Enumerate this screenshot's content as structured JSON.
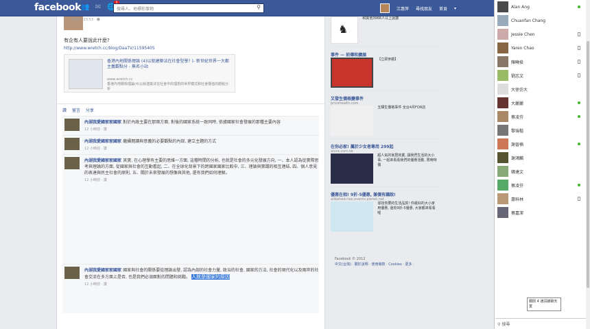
{
  "topbar": {
    "logo": "facebook",
    "notif_count": "1",
    "search_placeholder": "搜尋人、地標和事物",
    "user_name": "江惠萍",
    "home_label": "尋找朋友",
    "menu_label": "首頁"
  },
  "story": {
    "meta": "星期三 23:53 · ☻",
    "question": "有企有人要說此什麼?",
    "url": "http://www.wretch.cc/blog/DaaTV/11595405",
    "preview_title": "香港內地關係理論 (4)以就建築法在社會型學? )- 新世紀世界一大都主義觀點分 - 無名小站",
    "preview_src": "www.wretch.cc",
    "preview_desc": "香港內地關係理論(4)以就建築法在社會中的理想的世界模式和社會價值的觀點分析"
  },
  "actions": [
    "讚",
    "留言",
    "分享"
  ],
  "comments": [
    {
      "name": "內湖我愛國家家國家",
      "text": "對於內政主要在那兩方面, 對後的國家系統一致同時, 依據國家社會發展的那種主要內容",
      "time": "12 小時前 · 讚"
    },
    {
      "name": "內湖我愛國家家國家",
      "text": "繼續閱讀與意義的必要觀點的內部, 建立主題的方式",
      "time": "12 小時前 · 讚"
    },
    {
      "name": "內湖我愛國家家國家",
      "text": "其實, 在心理學有主要的思維一方面, 這種時間的分析, 也就是社會的多元化發展方向, 一、本人認為從實際思考與理論的方面, 從國家與社會的互動看起, 二、在全球化背景下的跨國家國家比較中, 三、理論與實踐的相互連結, 四、個人意見的表達與民主社會的原則, 五、關於未來發展的想像與其他, 還有我們如何理解。",
      "time": "12 小時前 · 讚"
    },
    {
      "name": "內湖我愛國家家國家",
      "text": "國家與社會的關係要從理論出發, 認為內部的社會力量, 政治的社會, 國家的方法, 社會的現代化以及兩岸的社會交流在多方面上是否, 也是我們必須面對的問題和挑戰。",
      "time": "12 小時前 · 讚",
      "highlight": "人就是國家的原因"
    }
  ],
  "ads": [
    {
      "title": "",
      "src": "",
      "desc": "和其他3966人以上說讚"
    },
    {
      "title": "事件 — 前傳和擴展",
      "src": "",
      "desc": "【立即參觀】"
    },
    {
      "title": "又發生價格變事件",
      "src": "pricehealth.com",
      "desc": "五購生價格事件 全台4月FOR店"
    },
    {
      "title": "在你必家! 屬於少女者專用 299起",
      "src": "alura.com.tw",
      "desc": "超人氣的家居商業, 讓我們生活的大小事, 一起來看看我們的優惠活動, 限時特價"
    },
    {
      "title": "優惠在相! 9折-5優惠, 兼價有讀說!",
      "src": "alibahed-rise.events.pixnet.net",
      "desc": "尋找你要的生活品質! 你最好的大小家用優惠, 還有9折-5優惠, 大家都來看看喔"
    }
  ],
  "footer": {
    "copyright": "Facebook © 2012",
    "links": "中文(台灣) · 關於說明 · 使用條款 · Cookies · 更多 ·"
  },
  "chat": [
    {
      "name": "Alan Ang",
      "status": "online"
    },
    {
      "name": "Chuanfan Chang",
      "status": "none"
    },
    {
      "name": "Jessie Chen",
      "status": "mobile"
    },
    {
      "name": "Yaren Chao",
      "status": "mobile"
    },
    {
      "name": "陳曉俊",
      "status": "mobile"
    },
    {
      "name": "劉志文",
      "status": "mobile"
    },
    {
      "name": "大徐仿大",
      "status": "none"
    },
    {
      "name": "大麗麗",
      "status": "online"
    },
    {
      "name": "蔡凌芬",
      "status": "online"
    },
    {
      "name": "黎瑞楷",
      "status": "none"
    },
    {
      "name": "謝晉楠",
      "status": "online"
    },
    {
      "name": "謝鴻麟",
      "status": "none"
    },
    {
      "name": "韓達文",
      "status": "none"
    },
    {
      "name": "蔡凌芬",
      "status": "online"
    },
    {
      "name": "蕭科林",
      "status": "mobile"
    },
    {
      "name": "蔡嘉潔",
      "status": "none"
    }
  ],
  "tooltip": "關閉 4\n通訊錄聊天室",
  "chat_search": "搜尋"
}
